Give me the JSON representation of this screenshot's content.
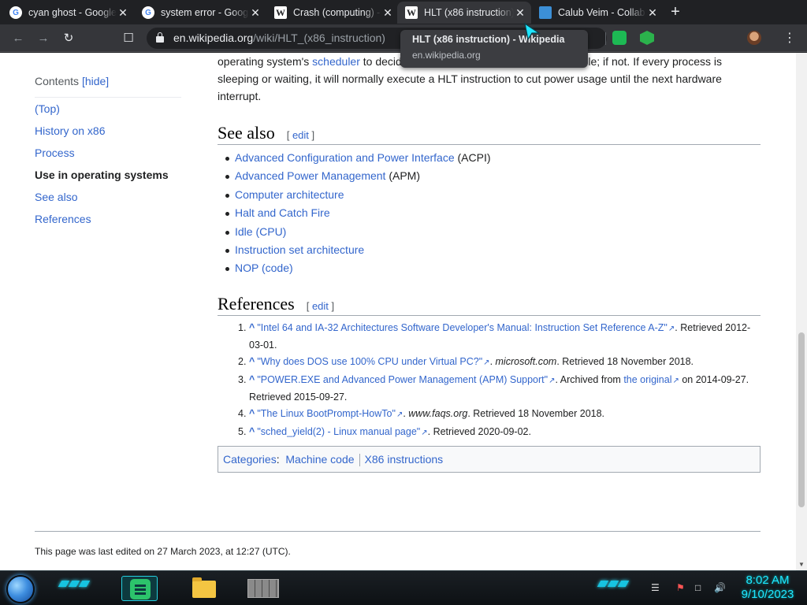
{
  "browser": {
    "tabs": [
      {
        "title": "cyan ghost - Google Search",
        "favicon": "google-icon",
        "active": false
      },
      {
        "title": "system error - Google Search",
        "favicon": "google-icon",
        "active": false
      },
      {
        "title": "Crash (computing) - Wikipedia",
        "favicon": "wikipedia-icon",
        "active": false
      },
      {
        "title": "HLT (x86 instruction) - Wikipedia",
        "favicon": "wikipedia-icon",
        "active": true
      },
      {
        "title": "Calub Veim - Collab",
        "favicon": "monitor-icon",
        "active": false
      }
    ],
    "url_host": "en.wikipedia.org",
    "url_path": "/wiki/HLT_(x86_instruction)",
    "tooltip": {
      "title": "HLT (x86 instruction) - Wikipedia",
      "domain": "en.wikipedia.org"
    }
  },
  "toc": {
    "label": "Contents",
    "toggle": "[hide]",
    "items": [
      {
        "label": "(Top)",
        "current": false
      },
      {
        "label": "History on x86",
        "current": false
      },
      {
        "label": "Process",
        "current": false
      },
      {
        "label": "Use in operating systems",
        "current": true
      },
      {
        "label": "See also",
        "current": false
      },
      {
        "label": "References",
        "current": false
      }
    ]
  },
  "article": {
    "intro_before": "operating system's ",
    "intro_link": "scheduler",
    "intro_after": " to decide whether other processes are runnable; if not. If every process is sleeping or waiting, it will normally execute a HLT instruction to cut power usage until the next hardware interrupt.",
    "edit_label": "edit",
    "see_also_heading": "See also",
    "see_also": [
      {
        "link": "Advanced Configuration and Power Interface",
        "suffix": " (ACPI)"
      },
      {
        "link": "Advanced Power Management",
        "suffix": " (APM)"
      },
      {
        "link": "Computer architecture",
        "suffix": ""
      },
      {
        "link": "Halt and Catch Fire",
        "suffix": ""
      },
      {
        "link": "Idle (CPU)",
        "suffix": ""
      },
      {
        "link": "Instruction set architecture",
        "suffix": ""
      },
      {
        "link": "NOP (code)",
        "suffix": ""
      }
    ],
    "references_heading": "References",
    "references": [
      {
        "num": "1.",
        "caret": "^",
        "link": "\"Intel 64 and IA-32 Architectures Software Developer's Manual: Instruction Set Reference A-Z\"",
        "site": "",
        "mid": "",
        "link2": "",
        "tail": ". Retrieved 2012-03-01."
      },
      {
        "num": "2.",
        "caret": "^",
        "link": "\"Why does DOS use 100% CPU under Virtual PC?\"",
        "site": "microsoft.com",
        "mid": "",
        "link2": "",
        "tail": ". Retrieved 18 November 2018."
      },
      {
        "num": "3.",
        "caret": "^",
        "link": "\"POWER.EXE and Advanced Power Management (APM) Support\"",
        "site": "",
        "mid": ". Archived from ",
        "link2": "the original",
        "tail": " on 2014-09-27. Retrieved 2015-09-27."
      },
      {
        "num": "4.",
        "caret": "^",
        "link": "\"The Linux BootPrompt-HowTo\"",
        "site": "www.faqs.org",
        "mid": "",
        "link2": "",
        "tail": ". Retrieved 18 November 2018."
      },
      {
        "num": "5.",
        "caret": "^",
        "link": "\"sched_yield(2) - Linux manual page\"",
        "site": "",
        "mid": "",
        "link2": "",
        "tail": ". Retrieved 2020-09-02."
      }
    ],
    "categories_label": "Categories",
    "categories": [
      "Machine code",
      "X86 instructions"
    ],
    "last_edited": "This page was last edited on 27 March 2023, at 12:27 (UTC)."
  },
  "taskbar": {
    "time": "8:02 AM",
    "date": "9/10/2023"
  },
  "colors": {
    "link": "#3366cc",
    "clock": "#1fe6ff",
    "taskbar_accent": "#17c3e0"
  }
}
